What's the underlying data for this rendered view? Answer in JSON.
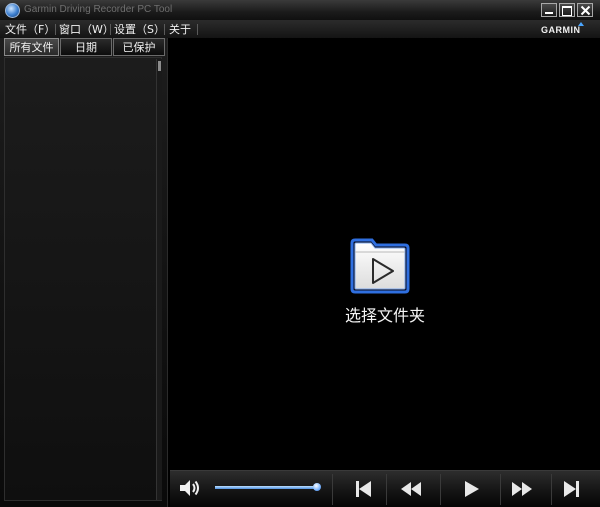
{
  "window": {
    "title": "Garmin Driving Recorder PC Tool",
    "brand": "GARMIN"
  },
  "menu": [
    {
      "label": "文件（F）"
    },
    {
      "label": "窗口（W）"
    },
    {
      "label": "设置（S）"
    },
    {
      "label": "关于"
    }
  ],
  "tabs": [
    {
      "label": "所有文件",
      "active": true
    },
    {
      "label": "日期",
      "active": false
    },
    {
      "label": "已保护",
      "active": false
    }
  ],
  "file_list": [],
  "main": {
    "select_folder_label": "选择文件夹",
    "select_folder_icon": "folder-play-icon"
  },
  "controls": {
    "volume_level": 0.98,
    "icons": [
      "volume-icon",
      "previous-icon",
      "rewind-icon",
      "play-icon",
      "fast-forward-icon",
      "next-icon"
    ]
  },
  "colors": {
    "background": "#000000",
    "accent": "#4d8fe0",
    "folder_glow": "#2f6fe0"
  }
}
